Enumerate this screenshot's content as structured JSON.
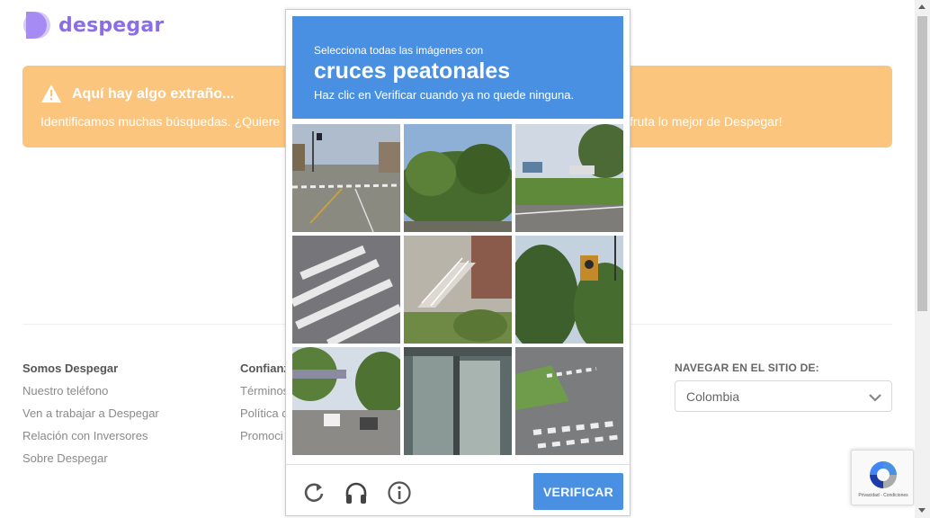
{
  "brand": {
    "name": "despegar",
    "color": "#8b6ee6"
  },
  "alert": {
    "title": "Aquí hay algo extraño...",
    "text_left": "Identificamos muchas búsquedas. ¿Quiere",
    "text_right": "fruta lo mejor de Despegar!",
    "bg_color": "#fbc57e",
    "icon": "warning-icon"
  },
  "footer": {
    "col1": {
      "title": "Somos Despegar",
      "links": [
        "Nuestro teléfono",
        "Ven a trabajar a Despegar",
        "Relación con Inversores",
        "Sobre Despegar"
      ]
    },
    "col2": {
      "title": "Confianz",
      "links": [
        "Términos",
        "Política c",
        "Promoci"
      ]
    },
    "nav": {
      "title": "NAVEGAR EN EL SITIO DE:",
      "selected": "Colombia"
    }
  },
  "captcha": {
    "instruction": "Selecciona todas las imágenes con",
    "target": "cruces peatonales",
    "hint": "Haz clic en Verificar cuando ya no quede ninguna.",
    "verify_label": "VERIFICAR",
    "header_color": "#4a90e2",
    "icons": [
      "reload-icon",
      "headphones-icon",
      "info-icon"
    ]
  },
  "recaptcha_badge": {
    "text": "Privacidad - Condiciones"
  }
}
